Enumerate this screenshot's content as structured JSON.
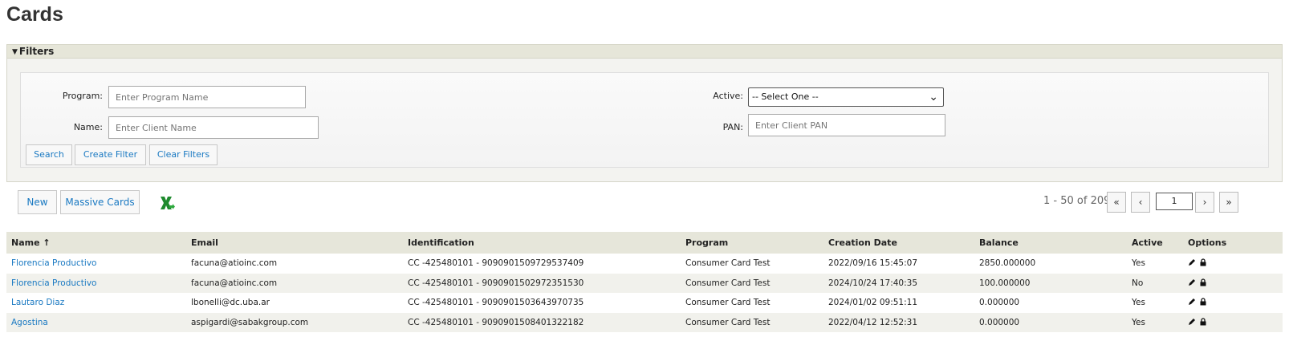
{
  "page": {
    "title": "Cards"
  },
  "filters": {
    "header": "Filters",
    "program_label": "Program:",
    "program_placeholder": "Enter Program Name",
    "name_label": "Name:",
    "name_placeholder": "Enter Client Name",
    "active_label": "Active:",
    "active_value": "-- Select One --",
    "pan_label": "PAN:",
    "pan_placeholder": "Enter Client PAN",
    "search_label": "Search",
    "create_filter_label": "Create Filter",
    "clear_filters_label": "Clear Filters"
  },
  "toolbar": {
    "new_label": "New",
    "massive_label": "Massive Cards",
    "export_icon": "excel-export-icon"
  },
  "pager": {
    "summary": "1 - 50 of 209",
    "first": "«",
    "prev": "‹",
    "page": "1",
    "next": "›",
    "last": "»"
  },
  "table": {
    "columns": [
      "Name ↑",
      "Email",
      "Identification",
      "Program",
      "Creation Date",
      "Balance",
      "Active",
      "Options"
    ],
    "rows": [
      [
        "Florencia Productivo",
        "facuna@atioinc.com",
        "CC -425480101 - 9090901509729537409",
        "Consumer Card Test",
        "2022/09/16 15:45:07",
        "2850.000000",
        "Yes"
      ],
      [
        "Florencia Productivo",
        "facuna@atioinc.com",
        "CC -425480101 - 9090901502972351530",
        "Consumer Card Test",
        "2024/10/24 17:40:35",
        "100.000000",
        "No"
      ],
      [
        "Lautaro Diaz",
        "lbonelli@dc.uba.ar",
        "CC -425480101 - 9090901503643970735",
        "Consumer Card Test",
        "2024/01/02 09:51:11",
        "0.000000",
        "Yes"
      ],
      [
        "Agostina",
        "aspigardi@sabakgroup.com",
        "CC -425480101 - 9090901508401322182",
        "Consumer Card Test",
        "2022/04/12 12:52:31",
        "0.000000",
        "Yes"
      ]
    ],
    "option_icons": [
      "edit-icon",
      "lock-icon"
    ]
  },
  "colors": {
    "link": "#1a79c2",
    "header_bg": "#e6e6da",
    "excel_green": "#1f8a2e"
  }
}
